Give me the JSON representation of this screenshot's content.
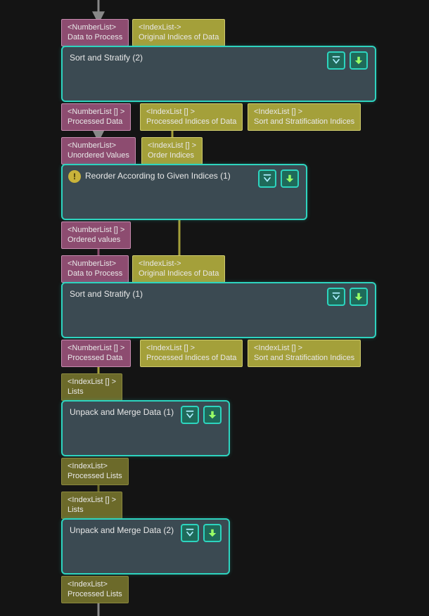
{
  "nodes": [
    {
      "id": "sort2",
      "title": "Sort and Stratify (2)",
      "inputs": [
        {
          "type": "<NumberList>",
          "name": "Data to Process",
          "style": "magenta"
        },
        {
          "type": "<IndexList->",
          "name": "Original Indices of Data",
          "style": "olive"
        }
      ],
      "outputs": [
        {
          "type": "<NumberList [] >",
          "name": "Processed Data",
          "style": "magenta"
        },
        {
          "type": "<IndexList [] >",
          "name": "Processed Indices of Data",
          "style": "olive"
        },
        {
          "type": "<IndexList [] >",
          "name": "Sort and Stratification Indices",
          "style": "olive"
        }
      ]
    },
    {
      "id": "reorder",
      "title": "Reorder According to Given Indices (1)",
      "warn": true,
      "inputs": [
        {
          "type": "<NumberList>",
          "name": "Unordered Values",
          "style": "magenta"
        },
        {
          "type": "<IndexList [] >",
          "name": "Order Indices",
          "style": "olive"
        }
      ],
      "outputs": [
        {
          "type": "<NumberList [] >",
          "name": "Ordered values",
          "style": "magenta"
        }
      ]
    },
    {
      "id": "sort1",
      "title": "Sort and Stratify (1)",
      "inputs": [
        {
          "type": "<NumberList>",
          "name": "Data to Process",
          "style": "magenta"
        },
        {
          "type": "<IndexList->",
          "name": "Original Indices of Data",
          "style": "olive"
        }
      ],
      "outputs": [
        {
          "type": "<NumberList [] >",
          "name": "Processed Data",
          "style": "magenta"
        },
        {
          "type": "<IndexList [] >",
          "name": "Processed Indices of Data",
          "style": "olive"
        },
        {
          "type": "<IndexList [] >",
          "name": "Sort and Stratification Indices",
          "style": "olive"
        }
      ]
    },
    {
      "id": "unpack1",
      "title": "Unpack and Merge Data (1)",
      "inputs": [
        {
          "type": "<IndexList [] >",
          "name": "Lists",
          "style": "darkolive"
        }
      ],
      "outputs": [
        {
          "type": "<IndexList>",
          "name": "Processed Lists",
          "style": "darkolive"
        }
      ]
    },
    {
      "id": "unpack2",
      "title": "Unpack and Merge Data (2)",
      "inputs": [
        {
          "type": "<IndexList [] >",
          "name": "Lists",
          "style": "darkolive"
        }
      ],
      "outputs": [
        {
          "type": "<IndexList>",
          "name": "Processed Lists",
          "style": "darkolive"
        }
      ]
    }
  ],
  "buttons": {
    "down": "collapse",
    "downfilled": "expand"
  }
}
